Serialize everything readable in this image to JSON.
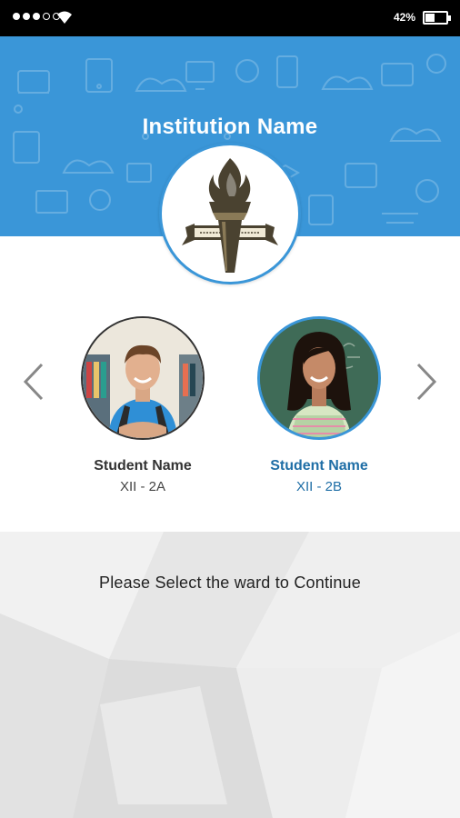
{
  "status_bar": {
    "signal_icon": "signal-dots-icon",
    "wifi_icon": "wifi-icon",
    "battery_percent": "42%",
    "battery_level": 0.42,
    "battery_icon": "battery-icon"
  },
  "header": {
    "title": "Institution Name",
    "background_color": "#3a96d8",
    "logo_icon": "torch-crest-icon"
  },
  "carousel": {
    "prev_icon": "chevron-left-icon",
    "next_icon": "chevron-right-icon",
    "students": [
      {
        "name": "Student Name",
        "class": "XII - 2A",
        "selected": false
      },
      {
        "name": "Student Name",
        "class": "XII - 2B",
        "selected": true
      }
    ],
    "selected_color": "#1f6ea6"
  },
  "footer": {
    "prompt": "Please Select the ward to Continue"
  }
}
